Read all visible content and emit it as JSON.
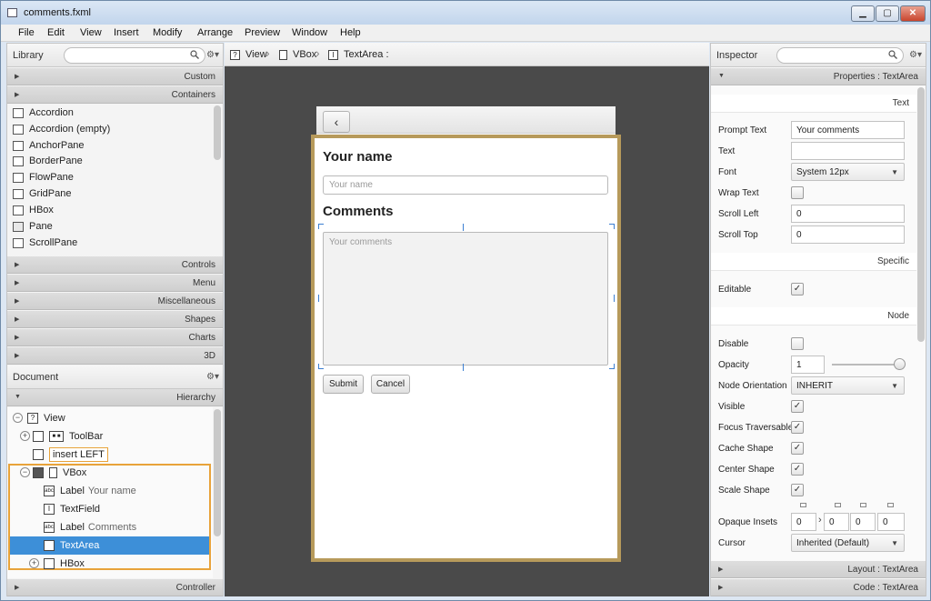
{
  "window": {
    "title": "comments.fxml"
  },
  "menu": [
    "File",
    "Edit",
    "View",
    "Insert",
    "Modify",
    "Arrange",
    "Preview",
    "Window",
    "Help"
  ],
  "library": {
    "title": "Library",
    "sections_top": [
      "Custom",
      "Containers"
    ],
    "items": [
      "Accordion",
      "Accordion  (empty)",
      "AnchorPane",
      "BorderPane",
      "FlowPane",
      "GridPane",
      "HBox",
      "Pane",
      "ScrollPane"
    ],
    "sections_bottom": [
      "Controls",
      "Menu",
      "Miscellaneous",
      "Shapes",
      "Charts",
      "3D"
    ]
  },
  "document": {
    "title": "Document",
    "hierarchy_label": "Hierarchy",
    "tree": {
      "view": "View",
      "toolbar": "ToolBar",
      "toolbar_icon": "■ ■",
      "insert_left": "insert LEFT",
      "vbox": "VBox",
      "label1": "Label",
      "label1_sub": "Your name",
      "textfield": "TextField",
      "label2": "Label",
      "label2_sub": "Comments",
      "textarea": "TextArea",
      "hbox": "HBox"
    },
    "controller": "Controller"
  },
  "breadcrumb": {
    "view": "View",
    "vbox": "VBox",
    "textarea": "TextArea :"
  },
  "canvas": {
    "name_heading": "Your name",
    "name_placeholder": "Your name",
    "comments_heading": "Comments",
    "comments_placeholder": "Your comments",
    "submit": "Submit",
    "cancel": "Cancel",
    "back": "‹"
  },
  "inspector": {
    "title": "Inspector",
    "properties_header": "Properties : TextArea",
    "text_section": "Text",
    "prompt_text_label": "Prompt Text",
    "prompt_text_value": "Your comments",
    "text_label": "Text",
    "text_value": "",
    "font_label": "Font",
    "font_value": "System 12px",
    "wrap_label": "Wrap Text",
    "scroll_left_label": "Scroll Left",
    "scroll_left_value": "0",
    "scroll_top_label": "Scroll Top",
    "scroll_top_value": "0",
    "specific_section": "Specific",
    "editable_label": "Editable",
    "node_section": "Node",
    "disable_label": "Disable",
    "opacity_label": "Opacity",
    "opacity_value": "1",
    "orientation_label": "Node Orientation",
    "orientation_value": "INHERIT",
    "visible_label": "Visible",
    "focus_label": "Focus Traversable",
    "cache_label": "Cache Shape",
    "center_label": "Center Shape",
    "scale_label": "Scale Shape",
    "insets_label": "Opaque Insets",
    "insets_values": [
      "0",
      "0",
      "0",
      "0"
    ],
    "cursor_label": "Cursor",
    "cursor_value": "Inherited (Default)",
    "layout_footer": "Layout : TextArea",
    "code_footer": "Code : TextArea"
  },
  "colors": {
    "selection": "#3d8fd8",
    "vbox_border": "#b79a5b",
    "highlight_border": "#e8a33a"
  }
}
